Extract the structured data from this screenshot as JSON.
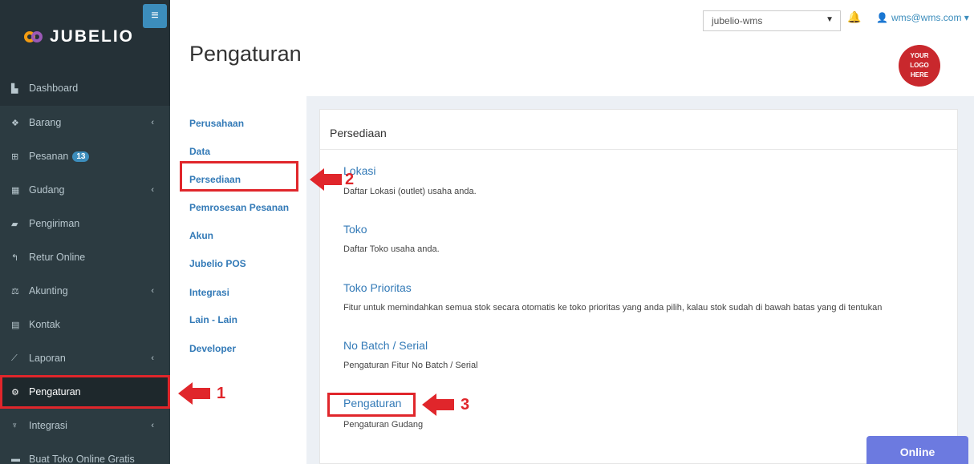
{
  "brand": {
    "name": "JUBELIO"
  },
  "sidebar": {
    "items": [
      {
        "label": "Dashboard",
        "icon": "dashboard-icon",
        "chev": ""
      },
      {
        "label": "Barang",
        "icon": "cubes-icon",
        "chev": "‹"
      },
      {
        "label": "Pesanan",
        "icon": "basket-icon",
        "badge": "13",
        "chev": ""
      },
      {
        "label": "Gudang",
        "icon": "building-icon",
        "chev": "‹"
      },
      {
        "label": "Pengiriman",
        "icon": "truck-icon",
        "chev": ""
      },
      {
        "label": "Retur Online",
        "icon": "reply-icon",
        "chev": ""
      },
      {
        "label": "Akunting",
        "icon": "balance-scale-icon",
        "chev": "‹"
      },
      {
        "label": "Kontak",
        "icon": "address-card-icon",
        "chev": ""
      },
      {
        "label": "Laporan",
        "icon": "line-chart-icon",
        "chev": "‹"
      },
      {
        "label": "Pengaturan",
        "icon": "cogs-icon",
        "chev": "",
        "active": true
      },
      {
        "label": "Integrasi",
        "icon": "plug-icon",
        "chev": "‹"
      },
      {
        "label": "Buat Toko Online Gratis",
        "icon": "cart-icon",
        "chev": ""
      }
    ]
  },
  "header": {
    "title": "Pengaturan",
    "company_select": "jubelio-wms",
    "user_email": "wms@wms.com",
    "logo_text": [
      "YOUR",
      "LOGO",
      "HERE"
    ]
  },
  "settings_menu": [
    "Perusahaan",
    "Data",
    "Persediaan",
    "Pemrosesan Pesanan",
    "Akun",
    "Jubelio POS",
    "Integrasi",
    "Lain - Lain",
    "Developer"
  ],
  "panel": {
    "title": "Persediaan",
    "entries": [
      {
        "title": "Lokasi",
        "desc": "Daftar Lokasi (outlet) usaha anda."
      },
      {
        "title": "Toko",
        "desc": "Daftar Toko usaha anda."
      },
      {
        "title": "Toko Prioritas",
        "desc": "Fitur untuk memindahkan semua stok secara otomatis ke toko prioritas yang anda pilih, kalau stok sudah di bawah batas yang di tentukan"
      },
      {
        "title": "No Batch / Serial",
        "desc": "Pengaturan Fitur No Batch / Serial"
      },
      {
        "title": "Pengaturan",
        "desc": "Pengaturan Gudang"
      }
    ]
  },
  "annotations": {
    "step1": "1",
    "step2": "2",
    "step3": "3"
  },
  "online_button": "Online",
  "colors": {
    "sidebar": "#2c3b41",
    "accent": "#3c8dbc",
    "highlight": "#e0262b",
    "online": "#6c7ae0"
  }
}
